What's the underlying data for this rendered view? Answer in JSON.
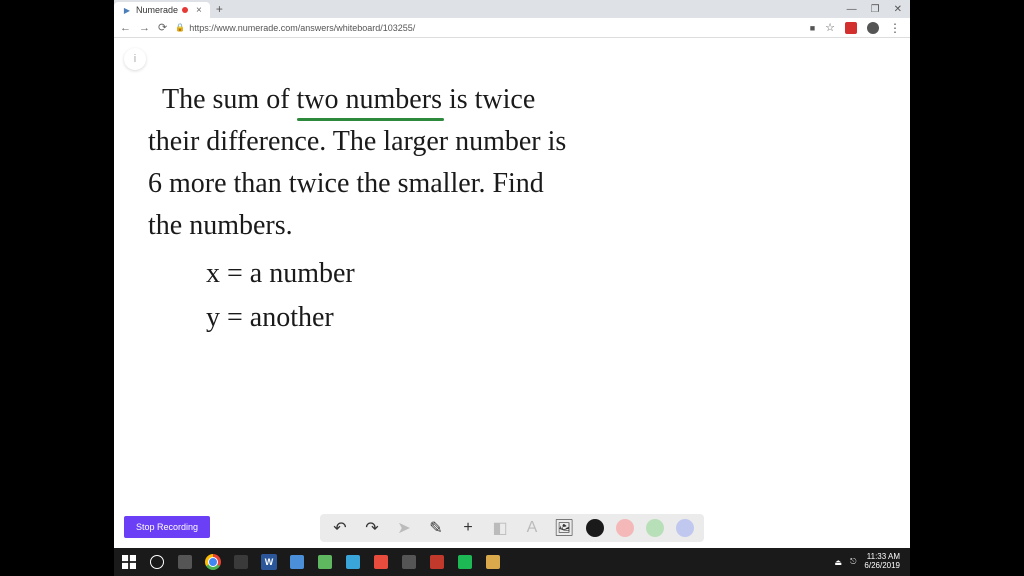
{
  "tab": {
    "title": "Numerade",
    "close": "×",
    "new_tab": "+"
  },
  "window_controls": {
    "minimize": "—",
    "maximize": "❐",
    "close": "✕"
  },
  "address": {
    "url": "https://www.numerade.com/answers/whiteboard/103255/",
    "menu": "⋮"
  },
  "help_btn": "i",
  "whiteboard": {
    "line1_a": "The sum of ",
    "line1_underlined": "two numbers",
    "line1_b": "  is twice",
    "line2": "their difference. The larger number is",
    "line3": "6 more than twice the smaller. Find",
    "line4": "the numbers.",
    "line5": "x = a number",
    "line6": "y = another"
  },
  "stop_recording": "Stop Recording",
  "toolbar": {
    "undo": "↶",
    "redo": "↷",
    "pointer": "➤",
    "pen": "✎",
    "plus": "+",
    "eraser": "◧",
    "text": "A",
    "image": "🖼"
  },
  "taskbar": {
    "word": "W",
    "time": "11:33 AM",
    "date": "6/26/2019"
  }
}
